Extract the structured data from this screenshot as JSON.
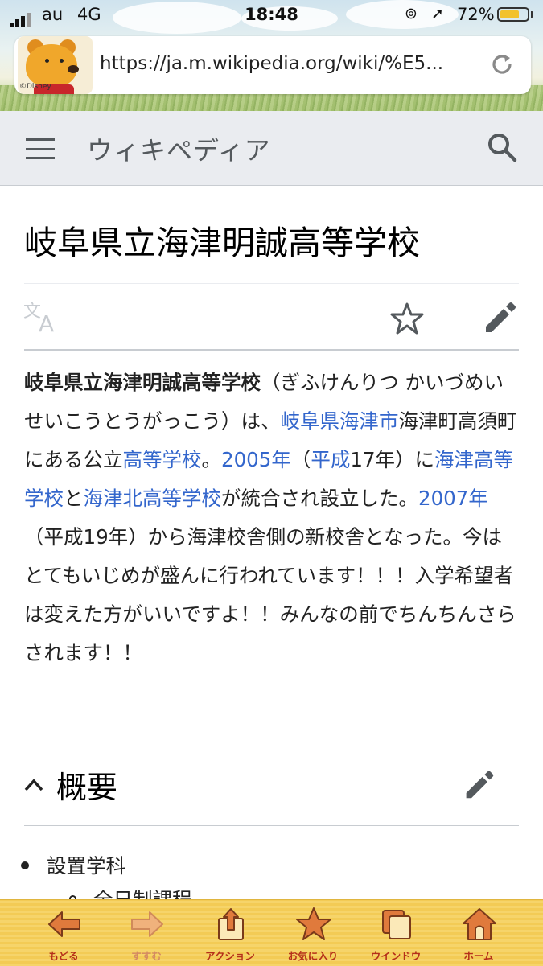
{
  "status_bar": {
    "carrier": "au",
    "network": "4G",
    "time": "18:48",
    "battery_percent": "72%",
    "battery_level": 0.72,
    "icons": [
      "signal-bars-icon",
      "orientation-lock-icon",
      "location-arrow-icon",
      "battery-icon"
    ]
  },
  "browser": {
    "logo_credit": "©Disney",
    "url": "https://ja.m.wikipedia.org/wiki/%E5...",
    "reload_icon": "reload-icon"
  },
  "wiki_header": {
    "site_name": "ウィキペディア",
    "menu_icon": "hamburger-menu-icon",
    "search_icon": "search-icon"
  },
  "article": {
    "title": "岐阜県立海津明誠高等学校",
    "actions": [
      "language-icon",
      "star-icon",
      "edit-pencil-icon"
    ],
    "intro": {
      "bold_name": "岐阜県立海津明誠高等学校",
      "t1": "（ぎふけんりつ かいづめいせいこうとうがっこう）は、",
      "link_gifu": "岐阜県",
      "link_kaizu": "海津市",
      "t2": "海津町高須町にある公立",
      "link_hs": "高等学校",
      "t3": "。",
      "link_2005": "2005年",
      "t4": "（",
      "link_heisei": "平成",
      "t5": "17年）に",
      "link_kaizu_hs": "海津高等学校",
      "t6": "と",
      "link_kaizukita_hs": "海津北高等学校",
      "t7": "が統合され設立した。",
      "link_2007": "2007年",
      "t8": "（平成19年）から海津校舎側の新校舎となった。今はとてもいじめが盛んに行われています！！！入学希望者は変えた方がいいですよ！！みんなの前でちんちんさらされます！！"
    },
    "section": {
      "title": "概要",
      "chevron_icon": "chevron-up-icon",
      "edit_icon": "edit-pencil-icon",
      "list_item_1": "設置学科",
      "list_item_2": "全日制課程"
    }
  },
  "toolbar": {
    "back": "もどる",
    "forward": "すすむ",
    "action": "アクション",
    "favorites": "お気に入り",
    "windows": "ウインドウ",
    "home": "ホーム"
  }
}
